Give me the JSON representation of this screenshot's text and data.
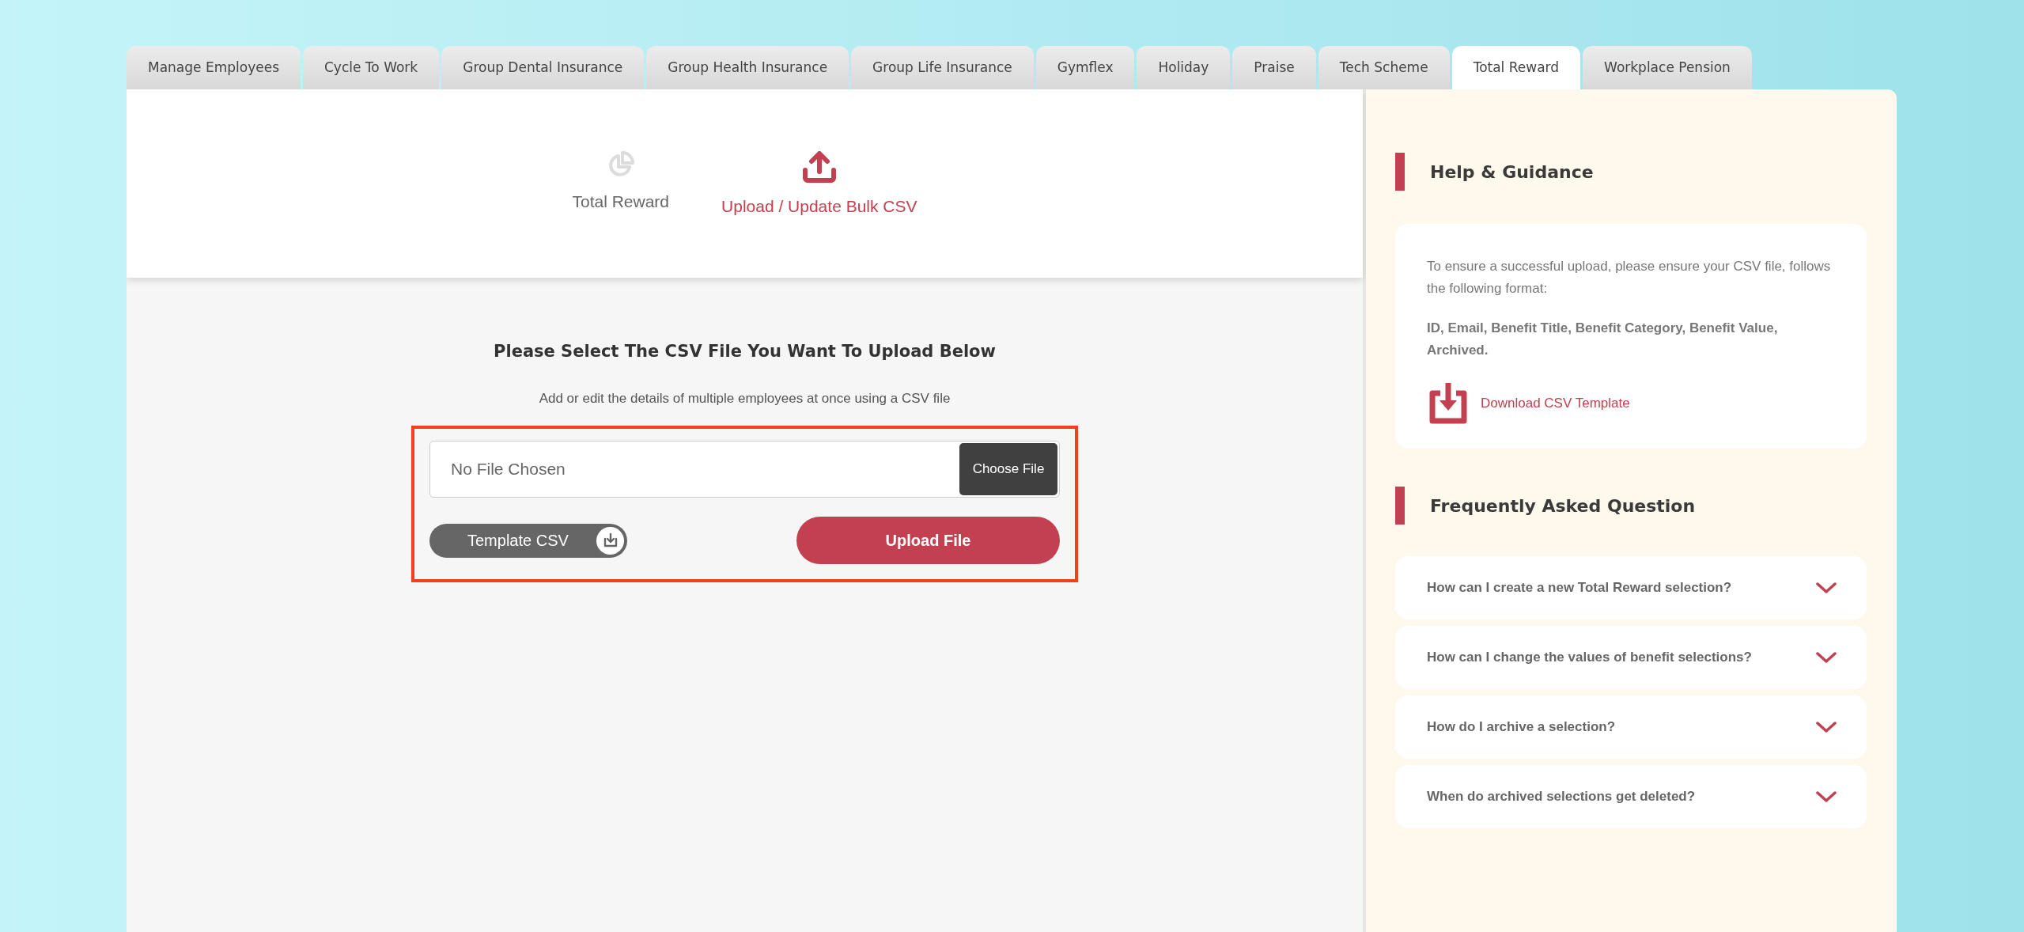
{
  "tabs": [
    {
      "label": "Manage Employees",
      "selected": false
    },
    {
      "label": "Cycle To Work",
      "selected": false
    },
    {
      "label": "Group Dental Insurance",
      "selected": false
    },
    {
      "label": "Group Health Insurance",
      "selected": false
    },
    {
      "label": "Group Life Insurance",
      "selected": false
    },
    {
      "label": "Gymflex",
      "selected": false
    },
    {
      "label": "Holiday",
      "selected": false
    },
    {
      "label": "Praise",
      "selected": false
    },
    {
      "label": "Tech Scheme",
      "selected": false
    },
    {
      "label": "Total Reward",
      "selected": true
    },
    {
      "label": "Workplace Pension",
      "selected": false
    }
  ],
  "sub_nav": [
    {
      "kind": "chart",
      "label": "Total Reward",
      "selected": false
    },
    {
      "kind": "upload",
      "label": "Upload / Update Bulk CSV",
      "selected": true
    }
  ],
  "upload": {
    "title": "Please Select The CSV File You Want To Upload Below",
    "subtitle": "Add or edit the details of multiple employees at once using a CSV file",
    "file_field": {
      "placeholder": "No File Chosen",
      "button": "Choose File"
    },
    "template_button": "Template CSV",
    "upload_button": "Upload File"
  },
  "help": {
    "title": "Help & Guidance",
    "intro": "To ensure a successful upload, please ensure your CSV file, follows the following format:",
    "format": "ID, Email, Benefit Title, Benefit Category, Benefit Value, Archived.",
    "download_link": "Download CSV Template"
  },
  "faq": {
    "title": "Frequently Asked Question",
    "items": [
      {
        "question": "How can I create a new Total Reward selection?",
        "expanded": false
      },
      {
        "question": "How can I change the values of benefit selections?",
        "expanded": false
      },
      {
        "question": "How do I archive a selection?",
        "expanded": false
      },
      {
        "question": "When do archived selections get deleted?",
        "expanded": false
      }
    ]
  }
}
